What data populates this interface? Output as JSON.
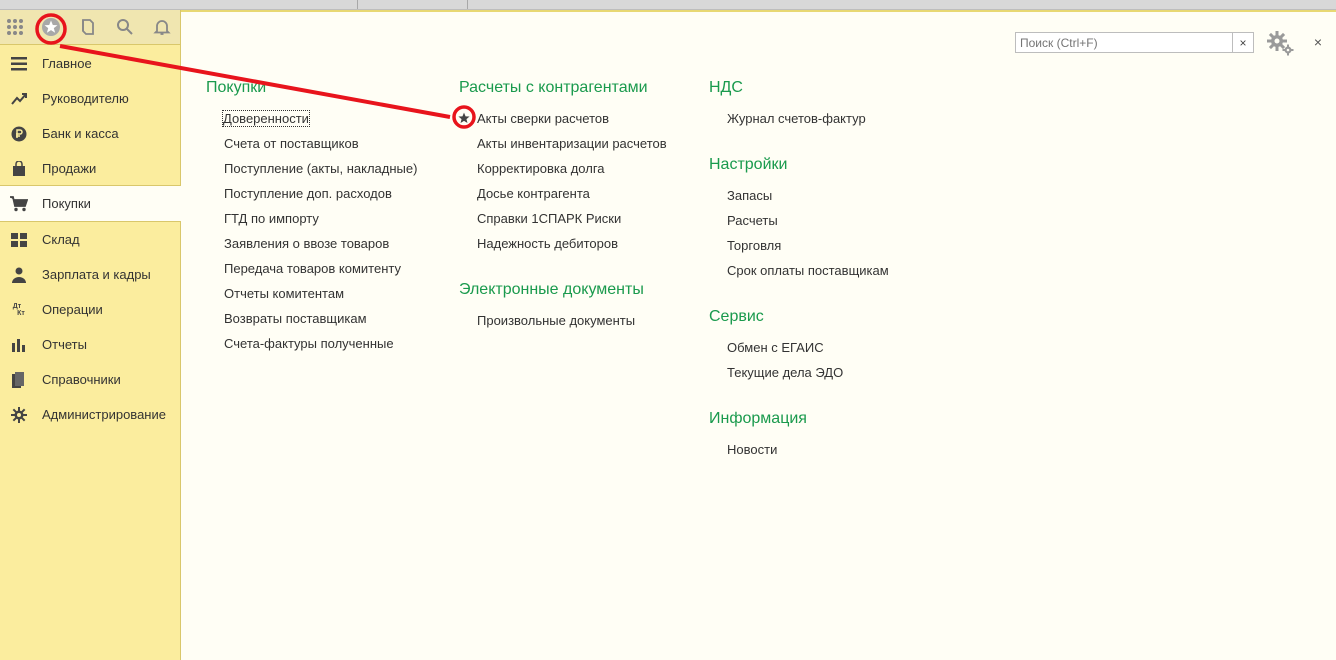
{
  "toolbar": {
    "icons": [
      "apps-grid-icon",
      "favorites-star-icon",
      "history-icon",
      "search-icon",
      "notifications-bell-icon"
    ]
  },
  "sidebar": {
    "items": [
      {
        "label": "Главное",
        "icon": "hamburger-icon"
      },
      {
        "label": "Руководителю",
        "icon": "trend-up-icon"
      },
      {
        "label": "Банк и касса",
        "icon": "ruble-coin-icon"
      },
      {
        "label": "Продажи",
        "icon": "shopping-bag-icon"
      },
      {
        "label": "Покупки",
        "icon": "cart-icon",
        "active": true
      },
      {
        "label": "Склад",
        "icon": "warehouse-grid-icon"
      },
      {
        "label": "Зарплата и кадры",
        "icon": "person-icon"
      },
      {
        "label": "Операции",
        "icon": "dt-kt-icon"
      },
      {
        "label": "Отчеты",
        "icon": "bar-chart-icon"
      },
      {
        "label": "Справочники",
        "icon": "books-icon"
      },
      {
        "label": "Администрирование",
        "icon": "gear-icon"
      }
    ]
  },
  "search": {
    "placeholder": "Поиск (Ctrl+F)",
    "clear_label": "×"
  },
  "close_label": "×",
  "dt_kt": {
    "top": "Дт",
    "bottom": "Кт"
  },
  "sections": {
    "purchases": {
      "title": "Покупки",
      "links": [
        "Доверенности",
        "Счета от поставщиков",
        "Поступление (акты, накладные)",
        "Поступление доп. расходов",
        "ГТД по импорту",
        "Заявления о ввозе товаров",
        "Передача товаров комитенту",
        "Отчеты комитентам",
        "Возвраты поставщикам",
        "Счета-фактуры полученные"
      ]
    },
    "settlements": {
      "title": "Расчеты с контрагентами",
      "links": [
        "Акты сверки расчетов",
        "Акты инвентаризации расчетов",
        "Корректировка долга",
        "Досье контрагента",
        "Справки 1СПАРК Риски",
        "Надежность дебиторов"
      ]
    },
    "edocs": {
      "title": "Электронные документы",
      "links": [
        "Произвольные документы"
      ]
    },
    "vat": {
      "title": "НДС",
      "links": [
        "Журнал счетов-фактур"
      ]
    },
    "settings": {
      "title": "Настройки",
      "links": [
        "Запасы",
        "Расчеты",
        "Торговля",
        "Срок оплаты поставщикам"
      ]
    },
    "service": {
      "title": "Сервис",
      "links": [
        "Обмен с ЕГАИС",
        "Текущие дела ЭДО"
      ]
    },
    "info": {
      "title": "Информация",
      "links": [
        "Новости"
      ]
    }
  },
  "colors": {
    "sidebar_bg": "#fbed9e",
    "section_title": "#1a9a4d",
    "annotation": "#e8141c"
  }
}
